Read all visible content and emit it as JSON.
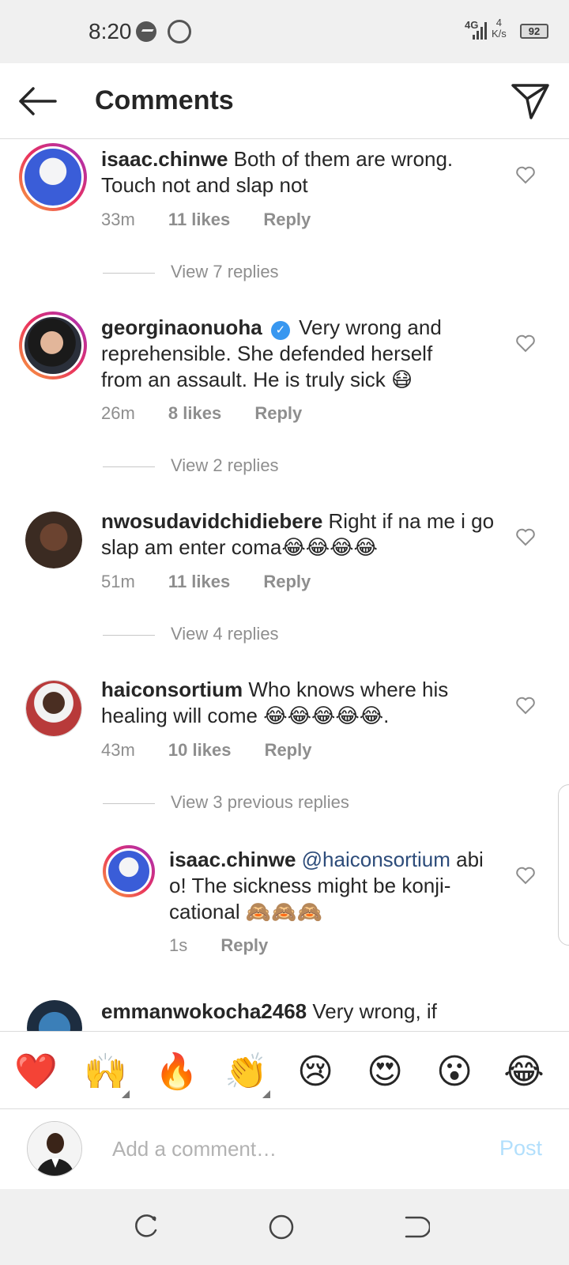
{
  "status": {
    "time": "8:20",
    "network": "4G",
    "speed_value": "4",
    "speed_unit": "K/s",
    "battery": "92"
  },
  "header": {
    "title": "Comments"
  },
  "comments": [
    {
      "username": "isaac.chinwe",
      "text": "Both of them are wrong. Touch not and slap not",
      "time": "33m",
      "likes": "11 likes",
      "reply": "Reply",
      "view_replies": "View 7 replies"
    },
    {
      "username": "georginaonuoha",
      "verified_mark": "✓",
      "text": "Very wrong and reprehensible. She defended herself from an assault. He is truly sick 😷",
      "time": "26m",
      "likes": "8 likes",
      "reply": "Reply",
      "view_replies": "View 2 replies"
    },
    {
      "username": "nwosudavidchidiebere",
      "text": "Right if na me i go slap am enter coma😂😂😂😂",
      "time": "51m",
      "likes": "11 likes",
      "reply": "Reply",
      "view_replies": "View 4 replies"
    },
    {
      "username": "haiconsortium",
      "text": "Who knows where his healing will come 😂😂😂😂😂.",
      "time": "43m",
      "likes": "10 likes",
      "reply": "Reply",
      "view_replies": "View 3 previous replies"
    }
  ],
  "reply": {
    "username": "isaac.chinwe",
    "mention": "@haiconsortium",
    "text": "abi o! The sickness might be konji-cational 🙈🙈🙈",
    "time": "1s",
    "reply": "Reply"
  },
  "partial_comment": {
    "username": "emmanwokocha2468",
    "text": "Very wrong, if"
  },
  "emojis": [
    "❤️",
    "🙌",
    "🔥",
    "👏",
    "😢",
    "😍",
    "😮",
    "😂"
  ],
  "input": {
    "placeholder": "Add a comment…",
    "value": "",
    "post_label": "Post"
  },
  "colors": {
    "accent": "#3897f0",
    "post_disabled": "#b2dffc",
    "meta_gray": "#8e8e8e",
    "heart": "#ed4956"
  }
}
